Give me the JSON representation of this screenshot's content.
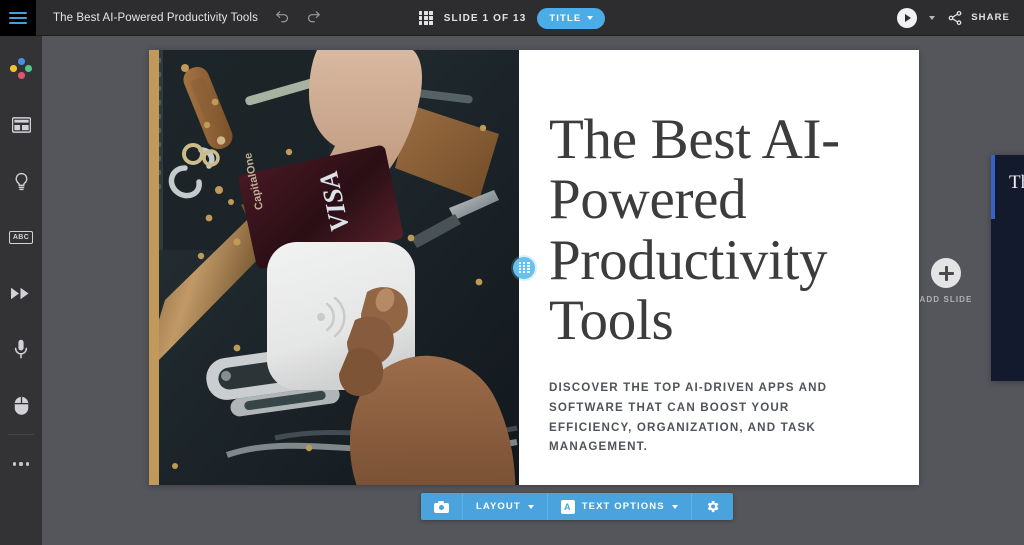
{
  "topbar": {
    "menu_icon": "hamburger-menu-icon",
    "document_title": "The Best AI-Powered Productivity Tools",
    "undo_icon": "undo-icon",
    "redo_icon": "redo-icon",
    "grid_icon": "grid-view-icon",
    "slide_count": "SLIDE 1 OF 13",
    "layout_pill_label": "TITLE",
    "play_icon": "play-icon",
    "share_icon": "share-icon",
    "share_label": "SHARE"
  },
  "sidebar": {
    "items": [
      {
        "name": "design-dots-icon",
        "label": "Design"
      },
      {
        "name": "layout-icon",
        "label": "Layout"
      },
      {
        "name": "lightbulb-icon",
        "label": "Ideas"
      },
      {
        "name": "abc-text-icon",
        "label": "ABC"
      },
      {
        "name": "fast-forward-icon",
        "label": "Transitions"
      },
      {
        "name": "microphone-icon",
        "label": "Record"
      },
      {
        "name": "mouse-pointer-icon",
        "label": "Presenter"
      },
      {
        "name": "more-options-icon",
        "label": "More"
      }
    ],
    "abc_label": "ABC"
  },
  "slide": {
    "title": "The Best AI-Powered Productivity Tools",
    "subtitle": "DISCOVER THE TOP AI-DRIVEN APPS AND SOFTWARE THAT CAN BOOST YOUR EFFICIENCY, ORGANIZATION, AND TASK MANAGEMENT.",
    "photo_description": "Two hands exchanging a contactless payment: a VISA Capital One credit card tapping a white Square card reader over a dark workbench with leather keyfob, hammer, knife and tools",
    "accent_strip_color": "#c19a5b",
    "divider_handle_icon": "drag-grid-handle-icon"
  },
  "canvas": {
    "add_slide_label": "ADD SLIDE",
    "add_slide_icon": "plus-icon",
    "next_slide_title": "Th",
    "next_slide_accent_color": "#3563c4",
    "background_color": "#54565c"
  },
  "format_toolbar": {
    "buttons": [
      {
        "name": "image-options-button",
        "label": "",
        "icon": "camera-icon",
        "has_caret": false
      },
      {
        "name": "layout-button",
        "label": "LAYOUT",
        "icon": "",
        "has_caret": true
      },
      {
        "name": "text-options-button",
        "label": "TEXT OPTIONS",
        "icon": "letter-a-icon",
        "has_caret": true
      },
      {
        "name": "slide-settings-button",
        "label": "",
        "icon": "gear-icon",
        "has_caret": false
      }
    ],
    "letter_a": "A"
  },
  "colors": {
    "accent_blue": "#4aade8",
    "toolbar_blue": "#4aa3dd",
    "topbar_dark": "#2d2d2f",
    "rail_dark": "#333336"
  }
}
